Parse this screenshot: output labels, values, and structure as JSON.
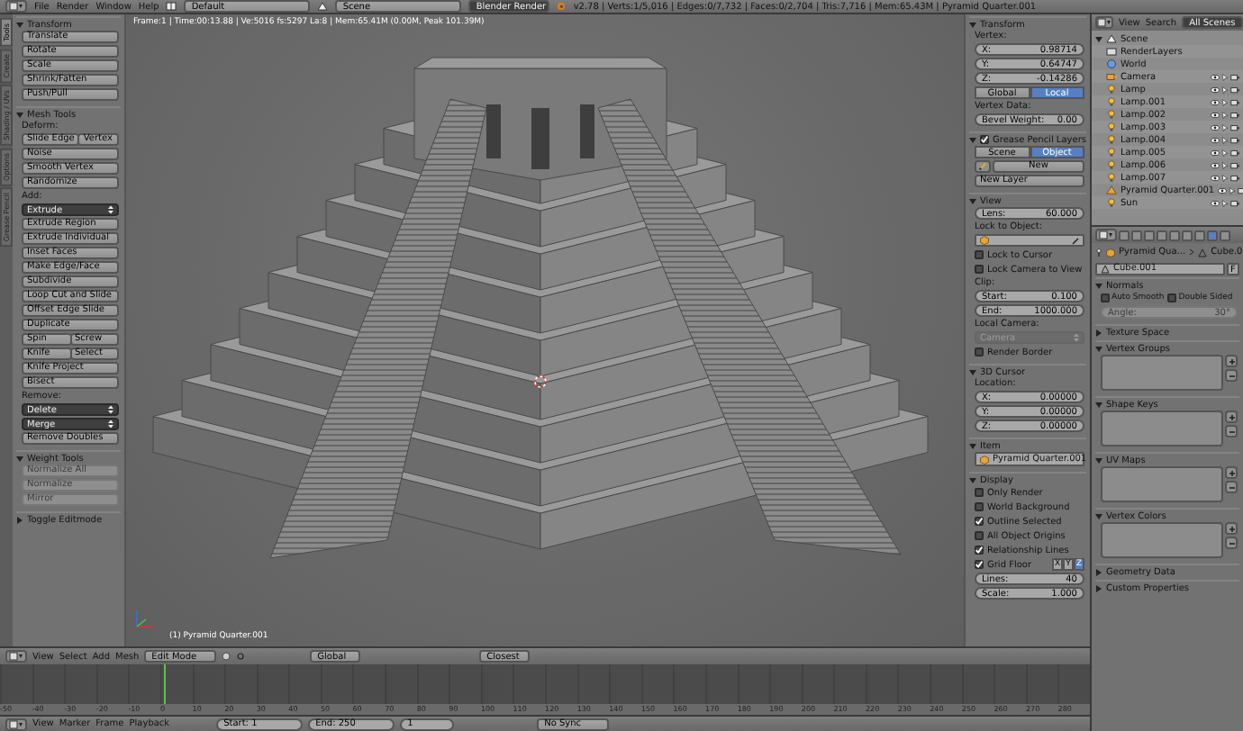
{
  "top_bar": {
    "menus": [
      "File",
      "Render",
      "Window",
      "Help"
    ],
    "screen_layout": "Default",
    "scene": "Scene",
    "render_engine": "Blender Render",
    "stats": "v2.78 | Verts:1/5,016 | Edges:0/7,732 | Faces:0/2,704 | Tris:7,716 | Mem:65.43M | Pyramid Quarter.001"
  },
  "tool_shelf": {
    "tabs": [
      {
        "label": "Tools",
        "selected": true
      },
      {
        "label": "Create",
        "selected": false
      },
      {
        "label": "Shading / UVs",
        "selected": false
      },
      {
        "label": "Options",
        "selected": false
      },
      {
        "label": "Grease Pencil",
        "selected": false
      }
    ],
    "panels": [
      {
        "title": "Transform",
        "expanded": true,
        "rows": [
          {
            "kind": "buttons",
            "labels": [
              "Translate"
            ],
            "disabled": false
          },
          {
            "kind": "buttons",
            "labels": [
              "Rotate"
            ],
            "disabled": false
          },
          {
            "kind": "buttons",
            "labels": [
              "Scale"
            ],
            "disabled": false
          },
          {
            "kind": "buttons",
            "labels": [
              "Shrink/Fatten"
            ],
            "disabled": false
          },
          {
            "kind": "buttons",
            "labels": [
              "Push/Pull"
            ],
            "disabled": false
          }
        ]
      },
      {
        "title": "Mesh Tools",
        "expanded": true,
        "rows": [
          {
            "kind": "label",
            "text": "Deform:"
          },
          {
            "kind": "buttons",
            "labels": [
              "Slide Edge",
              "Vertex"
            ],
            "disabled": false
          },
          {
            "kind": "buttons",
            "labels": [
              "Noise"
            ],
            "disabled": false
          },
          {
            "kind": "buttons",
            "labels": [
              "Smooth Vertex"
            ],
            "disabled": false
          },
          {
            "kind": "buttons",
            "labels": [
              "Randomize"
            ],
            "disabled": false
          },
          {
            "kind": "label",
            "text": "Add:"
          },
          {
            "kind": "dropdown",
            "text": "Extrude",
            "disabled": false
          },
          {
            "kind": "buttons",
            "labels": [
              "Extrude Region"
            ],
            "disabled": false
          },
          {
            "kind": "buttons",
            "labels": [
              "Extrude Individual"
            ],
            "disabled": false
          },
          {
            "kind": "buttons",
            "labels": [
              "Inset Faces"
            ],
            "disabled": false
          },
          {
            "kind": "buttons",
            "labels": [
              "Make Edge/Face"
            ],
            "disabled": false
          },
          {
            "kind": "buttons",
            "labels": [
              "Subdivide"
            ],
            "disabled": false
          },
          {
            "kind": "buttons",
            "labels": [
              "Loop Cut and Slide"
            ],
            "disabled": false
          },
          {
            "kind": "buttons",
            "labels": [
              "Offset Edge Slide"
            ],
            "disabled": false
          },
          {
            "kind": "buttons",
            "labels": [
              "Duplicate"
            ],
            "disabled": false
          },
          {
            "kind": "buttons",
            "labels": [
              "Spin",
              "Screw"
            ],
            "disabled": false
          },
          {
            "kind": "buttons",
            "labels": [
              "Knife",
              "Select"
            ],
            "disabled": false
          },
          {
            "kind": "buttons",
            "labels": [
              "Knife Project"
            ],
            "disabled": false
          },
          {
            "kind": "buttons",
            "labels": [
              "Bisect"
            ],
            "disabled": false
          },
          {
            "kind": "label",
            "text": "Remove:"
          },
          {
            "kind": "dropdown",
            "text": "Delete",
            "disabled": false
          },
          {
            "kind": "dropdown",
            "text": "Merge",
            "disabled": false
          },
          {
            "kind": "buttons",
            "labels": [
              "Remove Doubles"
            ],
            "disabled": false
          }
        ]
      },
      {
        "title": "Weight Tools",
        "expanded": true,
        "rows": [
          {
            "kind": "buttons",
            "labels": [
              "Normalize All"
            ],
            "disabled": true
          },
          {
            "kind": "buttons",
            "labels": [
              "Normalize"
            ],
            "disabled": true
          },
          {
            "kind": "buttons",
            "labels": [
              "Mirror"
            ],
            "disabled": true
          }
        ]
      },
      {
        "title": "Toggle Editmode",
        "expanded": false
      }
    ]
  },
  "viewport": {
    "info": "Frame:1 | Time:00:13.88 | Ve:5016 fs:5297 La:8 | Mem:65.41M (0.00M, Peak 101.39M)",
    "object_label": "(1) Pyramid Quarter.001"
  },
  "sidebar": {
    "panels": [
      {
        "title": "Transform",
        "expanded": true,
        "rows": [
          {
            "kind": "label",
            "text": "Vertex:"
          },
          {
            "kind": "number",
            "label": "X:",
            "value": "0.98714"
          },
          {
            "kind": "number",
            "label": "Y:",
            "value": "0.64747"
          },
          {
            "kind": "number",
            "label": "Z:",
            "value": "-0.14286"
          },
          {
            "kind": "toggle",
            "items": [
              {
                "label": "Global",
                "selected": false
              },
              {
                "label": "Local",
                "selected": true
              }
            ]
          },
          {
            "kind": "label",
            "text": "Vertex Data:"
          },
          {
            "kind": "number",
            "label": "Bevel Weight:",
            "value": "0.00"
          }
        ]
      },
      {
        "title": "Grease Pencil Layers",
        "checked": true,
        "expanded": true,
        "rows": [
          {
            "kind": "toggle",
            "items": [
              {
                "label": "Scene",
                "selected": false
              },
              {
                "label": "Object",
                "selected": true
              }
            ]
          },
          {
            "kind": "new",
            "text": "New"
          },
          {
            "kind": "buttons",
            "labels": [
              "New Layer"
            ],
            "disabled": false
          }
        ]
      },
      {
        "title": "View",
        "expanded": true,
        "rows": [
          {
            "kind": "number",
            "label": "Lens:",
            "value": "60.000"
          },
          {
            "kind": "label",
            "text": "Lock to Object:"
          },
          {
            "kind": "object_field"
          },
          {
            "kind": "checkbox",
            "label": "Lock to Cursor",
            "checked": false
          },
          {
            "kind": "checkbox",
            "label": "Lock Camera to View",
            "checked": false
          },
          {
            "kind": "label",
            "text": "Clip:"
          },
          {
            "kind": "number",
            "label": "Start:",
            "value": "0.100"
          },
          {
            "kind": "number",
            "label": "End:",
            "value": "1000.000"
          },
          {
            "kind": "label",
            "text": "Local Camera:"
          },
          {
            "kind": "dropdown",
            "text": "Camera",
            "disabled": true
          },
          {
            "kind": "checkbox",
            "label": "Render Border",
            "checked": false
          }
        ]
      },
      {
        "title": "3D Cursor",
        "expanded": true,
        "rows": [
          {
            "kind": "label",
            "text": "Location:"
          },
          {
            "kind": "number",
            "label": "X:",
            "value": "0.00000"
          },
          {
            "kind": "number",
            "label": "Y:",
            "value": "0.00000"
          },
          {
            "kind": "number",
            "label": "Z:",
            "value": "0.00000"
          }
        ]
      },
      {
        "title": "Item",
        "expanded": true,
        "rows": [
          {
            "kind": "object_field",
            "value": "Pyramid Quarter.001"
          }
        ]
      },
      {
        "title": "Display",
        "expanded": true,
        "rows": [
          {
            "kind": "checkbox",
            "label": "Only Render",
            "checked": false
          },
          {
            "kind": "checkbox",
            "label": "World Background",
            "checked": false
          },
          {
            "kind": "checkbox",
            "label": "Outline Selected",
            "checked": true
          },
          {
            "kind": "checkbox",
            "label": "All Object Origins",
            "checked": false
          },
          {
            "kind": "checkbox",
            "label": "Relationship Lines",
            "checked": true
          },
          {
            "kind": "grid_floor",
            "label": "Grid Floor",
            "checked": true,
            "axes": [
              {
                "label": "X",
                "selected": false
              },
              {
                "label": "Y",
                "selected": false
              },
              {
                "label": "Z",
                "selected": true
              }
            ]
          },
          {
            "kind": "number",
            "label": "Lines:",
            "value": "40"
          },
          {
            "kind": "number",
            "label": "Scale:",
            "value": "1.000"
          }
        ]
      }
    ]
  },
  "outliner": {
    "menus": [
      "View",
      "Search"
    ],
    "filter": "All Scenes",
    "tree": [
      {
        "label": "Scene",
        "kind": "scene",
        "expanded": true,
        "children": [
          {
            "label": "RenderLayers",
            "kind": "renderlayers"
          },
          {
            "label": "World",
            "kind": "world"
          },
          {
            "label": "Camera",
            "kind": "camera"
          },
          {
            "label": "Lamp",
            "kind": "lamp"
          },
          {
            "label": "Lamp.001",
            "kind": "lamp"
          },
          {
            "label": "Lamp.002",
            "kind": "lamp"
          },
          {
            "label": "Lamp.003",
            "kind": "lamp"
          },
          {
            "label": "Lamp.004",
            "kind": "lamp"
          },
          {
            "label": "Lamp.005",
            "kind": "lamp"
          },
          {
            "label": "Lamp.006",
            "kind": "lamp"
          },
          {
            "label": "Lamp.007",
            "kind": "lamp"
          },
          {
            "label": "Pyramid Quarter.001",
            "kind": "mesh"
          },
          {
            "label": "Sun",
            "kind": "lamp"
          }
        ]
      }
    ]
  },
  "properties": {
    "path": [
      "Pyramid Qua...",
      "Cube.0"
    ],
    "datablock": "Cube.001",
    "fake_user": "F",
    "panels": [
      {
        "title": "Normals",
        "expanded": true,
        "rows": [
          {
            "kind": "checkboxes",
            "items": [
              {
                "label": "Auto Smooth",
                "checked": false
              },
              {
                "label": "Double Sided",
                "checked": false
              }
            ]
          },
          {
            "kind": "number",
            "label": "Angle:",
            "value": "30°",
            "disabled": true
          }
        ]
      },
      {
        "title": "Texture Space",
        "expanded": false
      },
      {
        "title": "Vertex Groups",
        "expanded": true,
        "rows": [
          {
            "kind": "list"
          }
        ]
      },
      {
        "title": "Shape Keys",
        "expanded": true,
        "rows": [
          {
            "kind": "list"
          }
        ]
      },
      {
        "title": "UV Maps",
        "expanded": true,
        "rows": [
          {
            "kind": "list"
          }
        ]
      },
      {
        "title": "Vertex Colors",
        "expanded": true,
        "rows": [
          {
            "kind": "list"
          }
        ]
      },
      {
        "title": "Geometry Data",
        "expanded": false
      },
      {
        "title": "Custom Properties",
        "expanded": false
      }
    ]
  },
  "view3d_header": {
    "menus": [
      "View",
      "Select",
      "Add",
      "Mesh"
    ],
    "mode": "Edit Mode",
    "orientation": "Global",
    "snap": "Closest"
  },
  "timeline": {
    "ruler": [
      "-50",
      "-40",
      "-30",
      "-20",
      "-10",
      "0",
      "10",
      "20",
      "30",
      "40",
      "50",
      "60",
      "70",
      "80",
      "90",
      "100",
      "110",
      "120",
      "130",
      "140",
      "150",
      "160",
      "170",
      "180",
      "190",
      "200",
      "210",
      "220",
      "230",
      "240",
      "250",
      "260",
      "270",
      "280"
    ],
    "menus": [
      "View",
      "Marker",
      "Frame",
      "Playback"
    ],
    "start": "Start: 1",
    "end": "End: 250",
    "current_frame": "1",
    "sync": "No Sync"
  }
}
